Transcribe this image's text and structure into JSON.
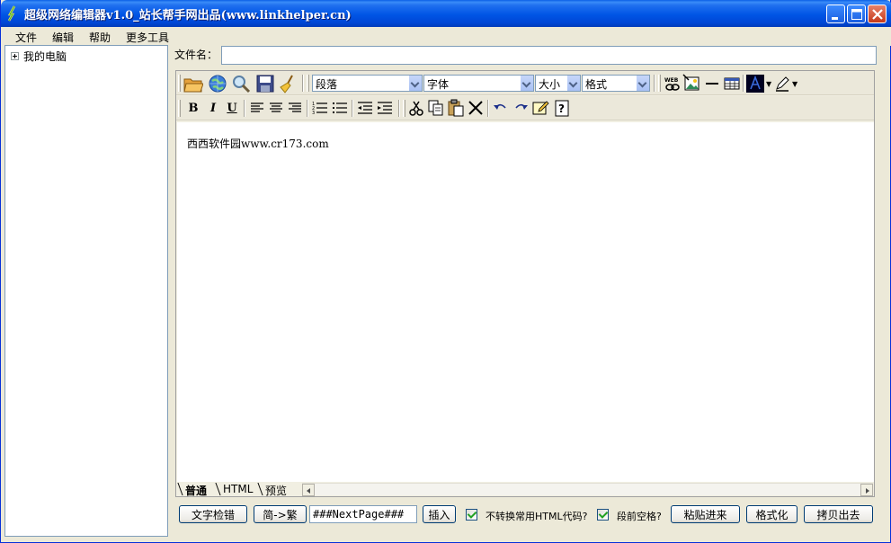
{
  "window": {
    "title": "超级网络编辑器v1.0_站长帮手网出品(www.linkhelper.cn)"
  },
  "menu": {
    "items": [
      "文件",
      "编辑",
      "帮助",
      "更多工具"
    ]
  },
  "tree": {
    "root_label": "我的电脑"
  },
  "file": {
    "label": "文件名：",
    "value": ""
  },
  "toolbar": {
    "paragraph_select": "段落",
    "font_select": "字体",
    "size_select": "大小",
    "format_select": "格式",
    "bold": "B",
    "italic": "I",
    "underline": "U"
  },
  "editor": {
    "content": "西西软件园www.cr173.com"
  },
  "tabs": [
    "普通",
    "HTML",
    "预览"
  ],
  "bottom": {
    "spell_check_button": "文字检错",
    "convert_button": "简->繁",
    "nextpage_value": "###NextPage###",
    "insert_button": "插入",
    "no_convert_html_label": "不转换常用HTML代码?",
    "indent_label": "段前空格?",
    "paste_button": "粘贴进来",
    "format_button": "格式化",
    "copy_out_button": "拷贝出去"
  },
  "colors": {
    "title_bar": "#0055E5",
    "window_bg": "#ECE9D8",
    "button_border": "#003C74",
    "checkbox_check": "#21A121"
  }
}
